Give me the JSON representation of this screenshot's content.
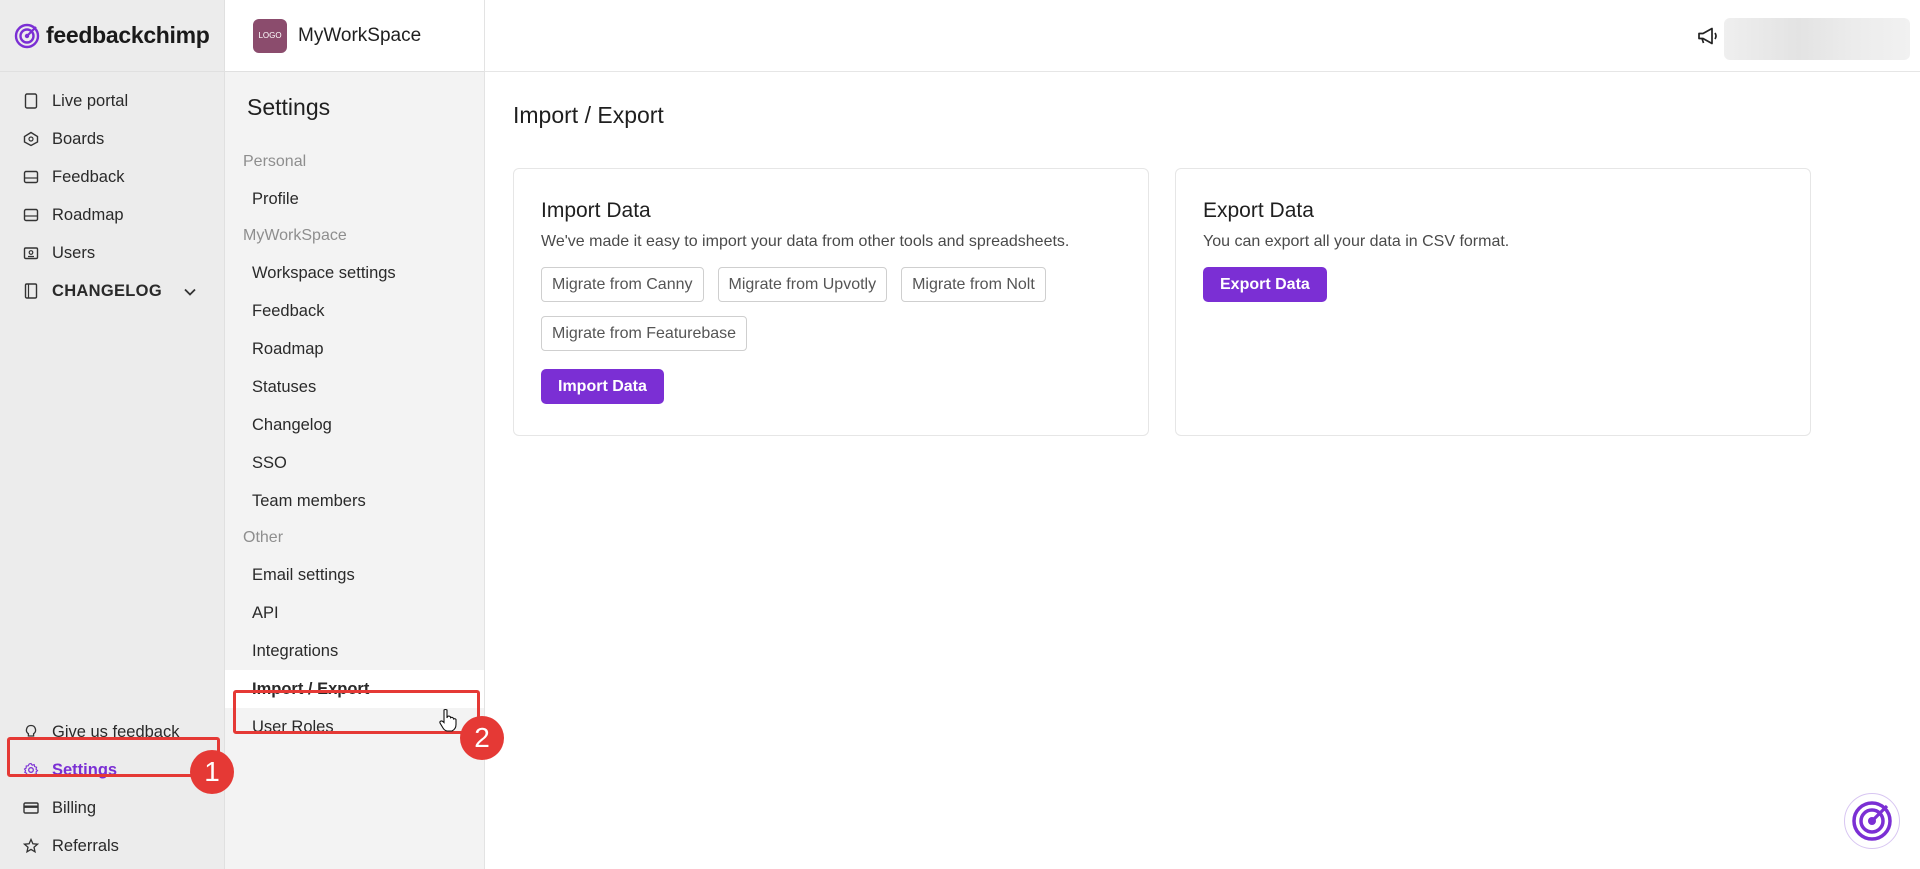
{
  "brand": {
    "name": "feedbackchimp",
    "accent": "#7b2fd4"
  },
  "sidebar": {
    "items": [
      {
        "label": "Live portal",
        "icon": "tablet-icon"
      },
      {
        "label": "Boards",
        "icon": "boards-icon"
      },
      {
        "label": "Feedback",
        "icon": "inbox-icon"
      },
      {
        "label": "Roadmap",
        "icon": "roadmap-icon"
      },
      {
        "label": "Users",
        "icon": "users-icon"
      },
      {
        "label": "CHANGELOG",
        "icon": "book-icon"
      }
    ],
    "bottom_items": [
      {
        "label": "Give us feedback",
        "icon": "lightbulb-icon"
      },
      {
        "label": "Settings",
        "icon": "gear-icon"
      },
      {
        "label": "Billing",
        "icon": "card-icon"
      },
      {
        "label": "Referrals",
        "icon": "star-icon"
      }
    ]
  },
  "workspace": {
    "logo_text": "LOGO",
    "name": "MyWorkSpace"
  },
  "settings": {
    "title": "Settings",
    "sections": [
      {
        "label": "Personal",
        "items": [
          "Profile"
        ]
      },
      {
        "label": "MyWorkSpace",
        "items": [
          "Workspace settings",
          "Feedback",
          "Roadmap",
          "Statuses",
          "Changelog",
          "SSO",
          "Team members"
        ]
      },
      {
        "label": "Other",
        "items": [
          "Email settings",
          "API",
          "Integrations",
          "Import / Export",
          "User Roles"
        ]
      }
    ],
    "active_item": "Import / Export"
  },
  "main": {
    "title": "Import / Export",
    "import_card": {
      "title": "Import Data",
      "description": "We've made it easy to import your data from other tools and spreadsheets.",
      "chips": [
        "Migrate from Canny",
        "Migrate from Upvotly",
        "Migrate from Nolt",
        "Migrate from Featurebase"
      ],
      "button": "Import Data"
    },
    "export_card": {
      "title": "Export Data",
      "description": "You can export all your data in CSV format.",
      "button": "Export Data"
    }
  },
  "annotations": {
    "step1": "1",
    "step2": "2",
    "color": "#e53935"
  }
}
